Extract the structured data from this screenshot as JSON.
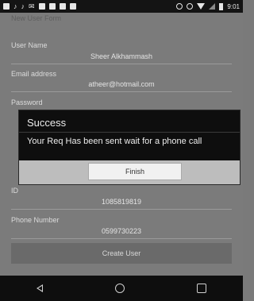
{
  "status_bar": {
    "time": "9:01",
    "icons": [
      "bbm-icon",
      "tiktok-icon",
      "tiktok-icon",
      "gmail-icon",
      "notification-icon",
      "notification-icon",
      "notification-icon",
      "image-icon",
      "do-not-disturb-icon",
      "alarm-icon",
      "wifi-icon",
      "signal-icon",
      "battery-icon"
    ]
  },
  "app": {
    "title": "New User Form"
  },
  "form": {
    "user_name": {
      "label": "User Name",
      "value": "Sheer Alkhammash"
    },
    "email": {
      "label": "Email address",
      "value": "atheer@hotmail.com"
    },
    "password": {
      "label": "Password"
    },
    "id": {
      "label": "ID",
      "value": "1085819819"
    },
    "phone": {
      "label": "Phone Number",
      "value": "0599730223"
    },
    "create_button": "Create User"
  },
  "dialog": {
    "title": "Success",
    "message": "Your Req Has been sent wait for a phone call",
    "button": "Finish"
  },
  "nav_bar": {
    "icons": [
      "back-icon",
      "home-icon",
      "recent-apps-icon"
    ]
  }
}
